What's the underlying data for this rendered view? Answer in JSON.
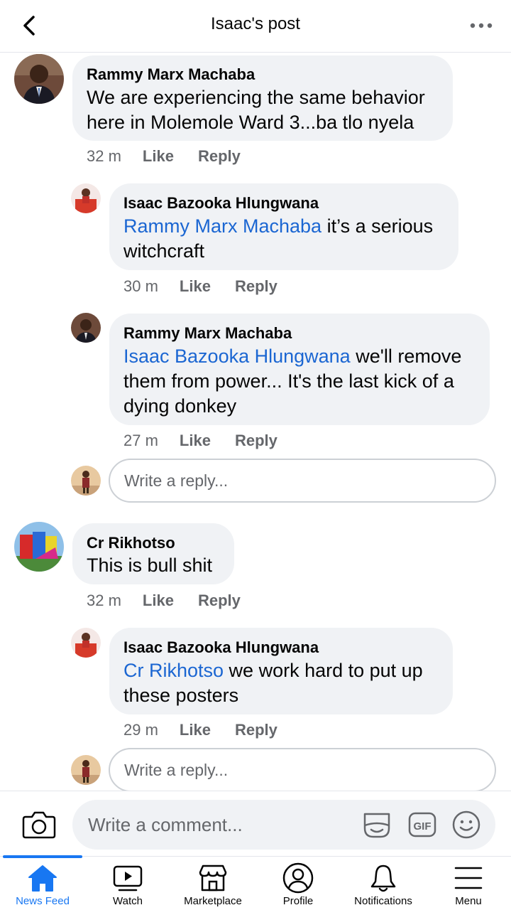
{
  "header": {
    "title": "Isaac's post",
    "back_icon": "chevron-left-icon",
    "more_icon": "more-horizontal-icon"
  },
  "colors": {
    "mention": "#1b66d2",
    "accent": "#1877f2",
    "bubble": "#f0f2f5",
    "meta": "#65676b"
  },
  "comments": [
    {
      "author": "Rammy Marx Machaba",
      "line1": "We are experiencing the same behavior",
      "line2": "here in Molemole Ward 3...ba tlo nyela",
      "time": "32 m",
      "like": "Like",
      "reply": "Reply",
      "replies": [
        {
          "author": "Isaac Bazooka Hlungwana",
          "mention": "Rammy Marx Machaba",
          "text1": " it’s a serious",
          "text2": "witchcraft",
          "time": "30 m",
          "like": "Like",
          "reply": "Reply"
        },
        {
          "author": "Rammy Marx Machaba",
          "mention": "Isaac Bazooka Hlungwana",
          "text1": " we'll remove",
          "text2": "them from power... It's the last kick of a",
          "text3": "dying donkey",
          "time": "27 m",
          "like": "Like",
          "reply": "Reply"
        }
      ],
      "reply_placeholder": "Write a reply..."
    },
    {
      "author": "Cr Rikhotso",
      "line1": "This is bull shit",
      "time": "32 m",
      "like": "Like",
      "reply": "Reply",
      "replies": [
        {
          "author": "Isaac Bazooka Hlungwana",
          "mention": "Cr Rikhotso",
          "text1": " we work hard to put up",
          "text2": "these posters",
          "time": "29 m",
          "like": "Like",
          "reply": "Reply"
        }
      ],
      "reply_placeholder": "Write a reply..."
    }
  ],
  "comment_bar": {
    "placeholder": "Write a comment...",
    "camera_icon": "camera-icon",
    "sticker_icon": "sticker-icon",
    "gif_icon": "gif-icon",
    "emoji_icon": "emoji-icon"
  },
  "nav": [
    {
      "label": "News Feed",
      "icon": "home-icon",
      "active": true
    },
    {
      "label": "Watch",
      "icon": "watch-icon"
    },
    {
      "label": "Marketplace",
      "icon": "marketplace-icon"
    },
    {
      "label": "Profile",
      "icon": "profile-icon"
    },
    {
      "label": "Notifications",
      "icon": "bell-icon"
    },
    {
      "label": "Menu",
      "icon": "menu-icon"
    }
  ]
}
